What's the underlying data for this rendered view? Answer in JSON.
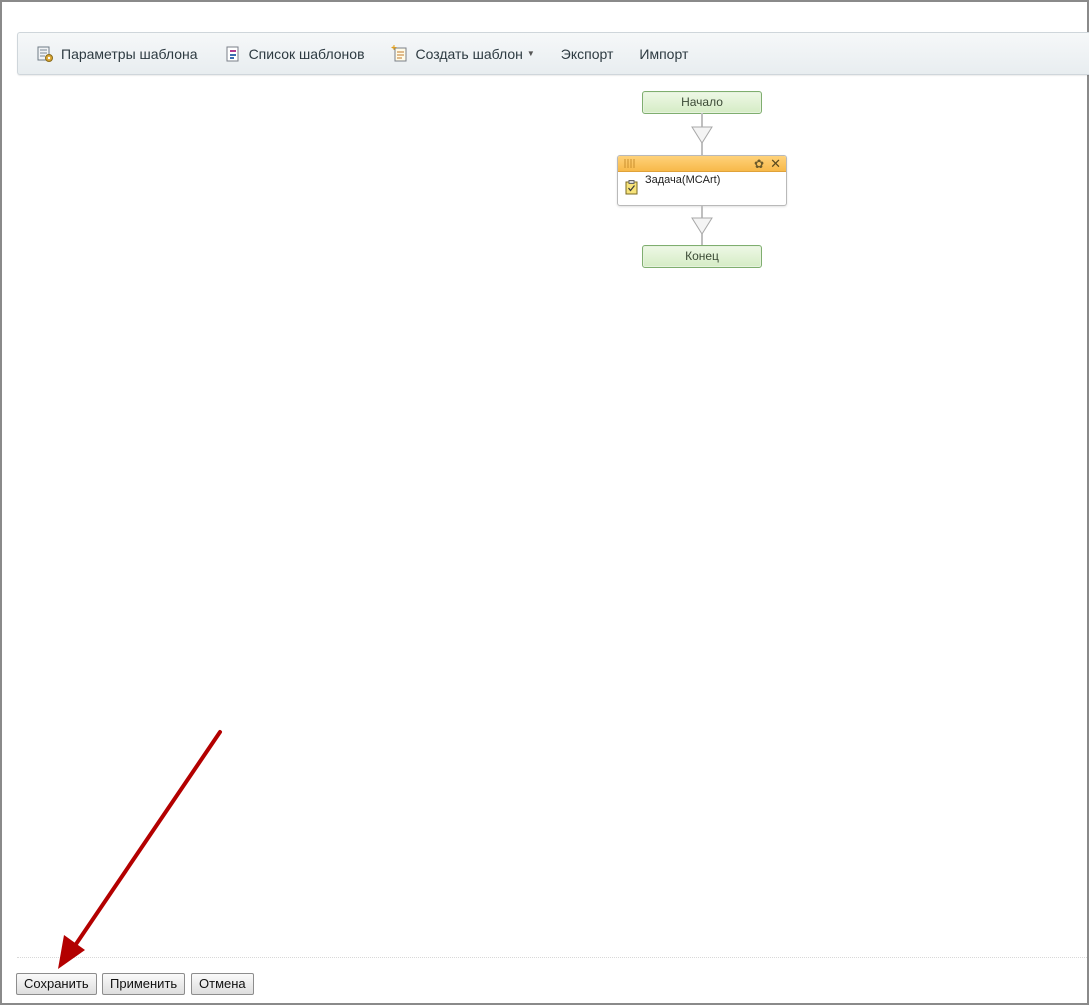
{
  "toolbar": {
    "items": [
      {
        "label": "Параметры шаблона",
        "icon": "template-settings-icon"
      },
      {
        "label": "Список шаблонов",
        "icon": "template-list-icon"
      },
      {
        "label": "Создать шаблон",
        "icon": "create-template-icon",
        "has_dropdown": true
      },
      {
        "label": "Экспорт"
      },
      {
        "label": "Импорт"
      }
    ]
  },
  "workflow": {
    "start_label": "Начало",
    "task": {
      "title": "Задача(MCArt)",
      "icon": "task-clipboard-icon",
      "header_color": "#f7b94a"
    },
    "end_label": "Конец",
    "node_color": "#d5ecc5"
  },
  "footer": {
    "save_label": "Сохранить",
    "apply_label": "Применить",
    "cancel_label": "Отмена"
  },
  "annotation": {
    "color": "#b30000",
    "points_to": "save-button"
  }
}
